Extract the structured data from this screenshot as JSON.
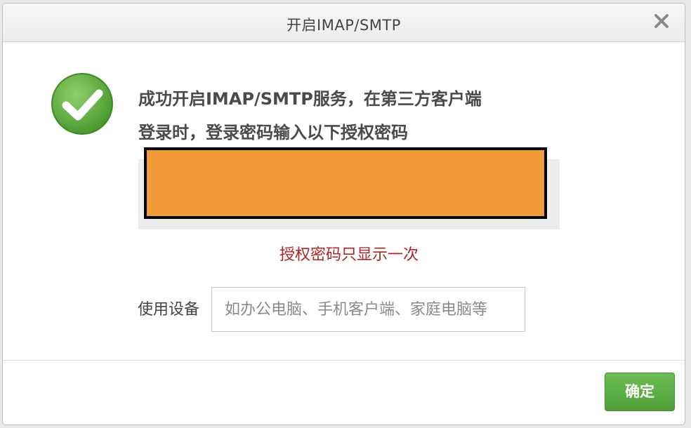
{
  "dialog": {
    "title": "开启IMAP/SMTP",
    "close_icon": "close-icon"
  },
  "success": {
    "icon": "checkmark-circle-icon",
    "line1": "成功开启IMAP/SMTP服务，在第三方客户端",
    "line2": "登录时，登录密码输入以下授权密码"
  },
  "auth_code": {
    "value": "",
    "redaction_color": "#f09a38"
  },
  "notice": "授权密码只显示一次",
  "device": {
    "label": "使用设备",
    "value": "",
    "placeholder": "如办公电脑、手机客户端、家庭电脑等"
  },
  "footer": {
    "ok_label": "确定",
    "ok_color": "#5aab42"
  }
}
